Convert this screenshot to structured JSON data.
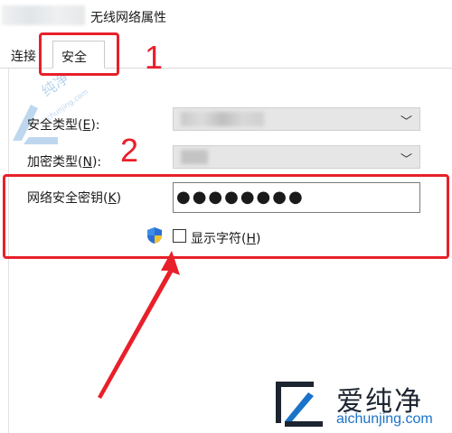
{
  "window": {
    "title": "无线网络属性"
  },
  "tabs": [
    {
      "label": "连接",
      "selected": false
    },
    {
      "label": "安全",
      "selected": true
    }
  ],
  "annotations": {
    "marker1": "1",
    "marker2": "2",
    "color": "#e8202a"
  },
  "security": {
    "type_label_prefix": "安全类型(",
    "type_label_key": "E",
    "type_label_suffix": "):",
    "enc_label_prefix": "加密类型(",
    "enc_label_key": "N",
    "enc_label_suffix": "):",
    "key_label_prefix": "网络安全密钥(",
    "key_label_key": "K",
    "key_label_suffix": ")",
    "key_value": "●●●●●●●●",
    "show_chars_prefix": "显示字符(",
    "show_chars_key": "H",
    "show_chars_suffix": ")",
    "show_chars_checked": false
  },
  "watermark": {
    "brand": "爱纯净",
    "url": "aichunjing.com",
    "small_text": "纯净",
    "small_url": "aichunjing.com"
  },
  "colors": {
    "accent_blue": "#1a73c8",
    "annotation_red": "#e8202a"
  }
}
